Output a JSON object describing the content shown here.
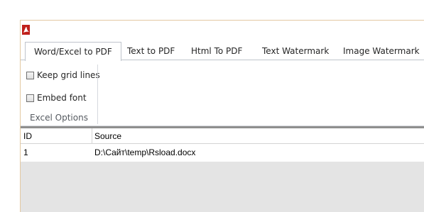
{
  "tabs": [
    {
      "label": "Word/Excel to PDF",
      "active": true
    },
    {
      "label": "Text to PDF",
      "active": false
    },
    {
      "label": "Html To PDF",
      "active": false
    },
    {
      "label": "Text Watermark",
      "active": false
    },
    {
      "label": "Image Watermark",
      "active": false
    }
  ],
  "ribbon": {
    "options": [
      {
        "label": "Keep grid lines",
        "checked": false
      },
      {
        "label": "Embed font",
        "checked": false
      }
    ],
    "group_label": "Excel Options"
  },
  "grid": {
    "columns": [
      "ID",
      "Source"
    ],
    "rows": [
      [
        "1",
        "D:\\Сайт\\temp\\Rsload.docx"
      ]
    ]
  },
  "colors": {
    "accent_border": "#e3c9a2",
    "pdf_icon_red": "#c0201a",
    "grid_background": "#e4e4e4"
  },
  "icons": {
    "app": "pdf-icon"
  }
}
